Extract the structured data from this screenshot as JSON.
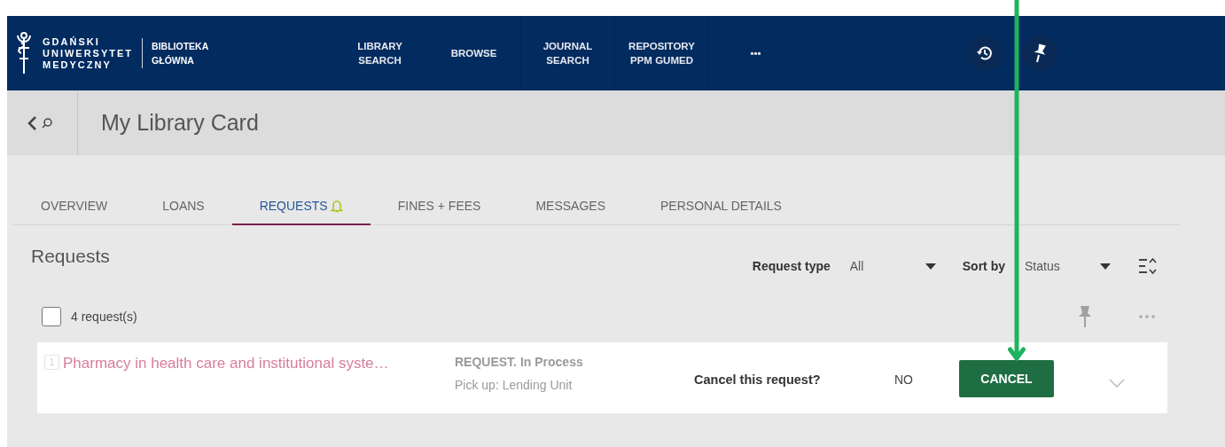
{
  "brand": {
    "university": [
      "GDAŃSKI",
      "UNIWERSYTET",
      "MEDYCZNY"
    ],
    "library": [
      "BIBLIOTEKA",
      "GŁÓWNA"
    ]
  },
  "nav": [
    {
      "lines": [
        "LIBRARY",
        "SEARCH"
      ]
    },
    {
      "lines": [
        "BROWSE"
      ]
    },
    {
      "lines": [
        "JOURNAL",
        "SEARCH"
      ]
    },
    {
      "lines": [
        "REPOSITORY",
        "PPM GUMED"
      ]
    },
    {
      "lines": [
        "•••"
      ]
    }
  ],
  "header": {
    "title": "My Library Card"
  },
  "tabs": [
    {
      "label": "OVERVIEW",
      "selected": false,
      "alert": false
    },
    {
      "label": "LOANS",
      "selected": false,
      "alert": false
    },
    {
      "label": "REQUESTS",
      "selected": true,
      "alert": true
    },
    {
      "label": "FINES + FEES",
      "selected": false,
      "alert": false
    },
    {
      "label": "MESSAGES",
      "selected": false,
      "alert": false
    },
    {
      "label": "PERSONAL DETAILS",
      "selected": false,
      "alert": false
    }
  ],
  "section_title": "Requests",
  "filters": [
    {
      "label": "Request type",
      "value": "All"
    },
    {
      "label": "Sort by",
      "value": "Status"
    }
  ],
  "select_all": {
    "checked": false,
    "label": "4 request(s)"
  },
  "requests": [
    {
      "number": "1",
      "title": "Pharmacy in health care and institutional syste…",
      "status": "REQUEST. In Process",
      "pickup": "Pick up: Lending Unit",
      "dimmed": true,
      "prompt": "Cancel this request?",
      "no": "NO",
      "confirm": "CANCEL"
    }
  ]
}
